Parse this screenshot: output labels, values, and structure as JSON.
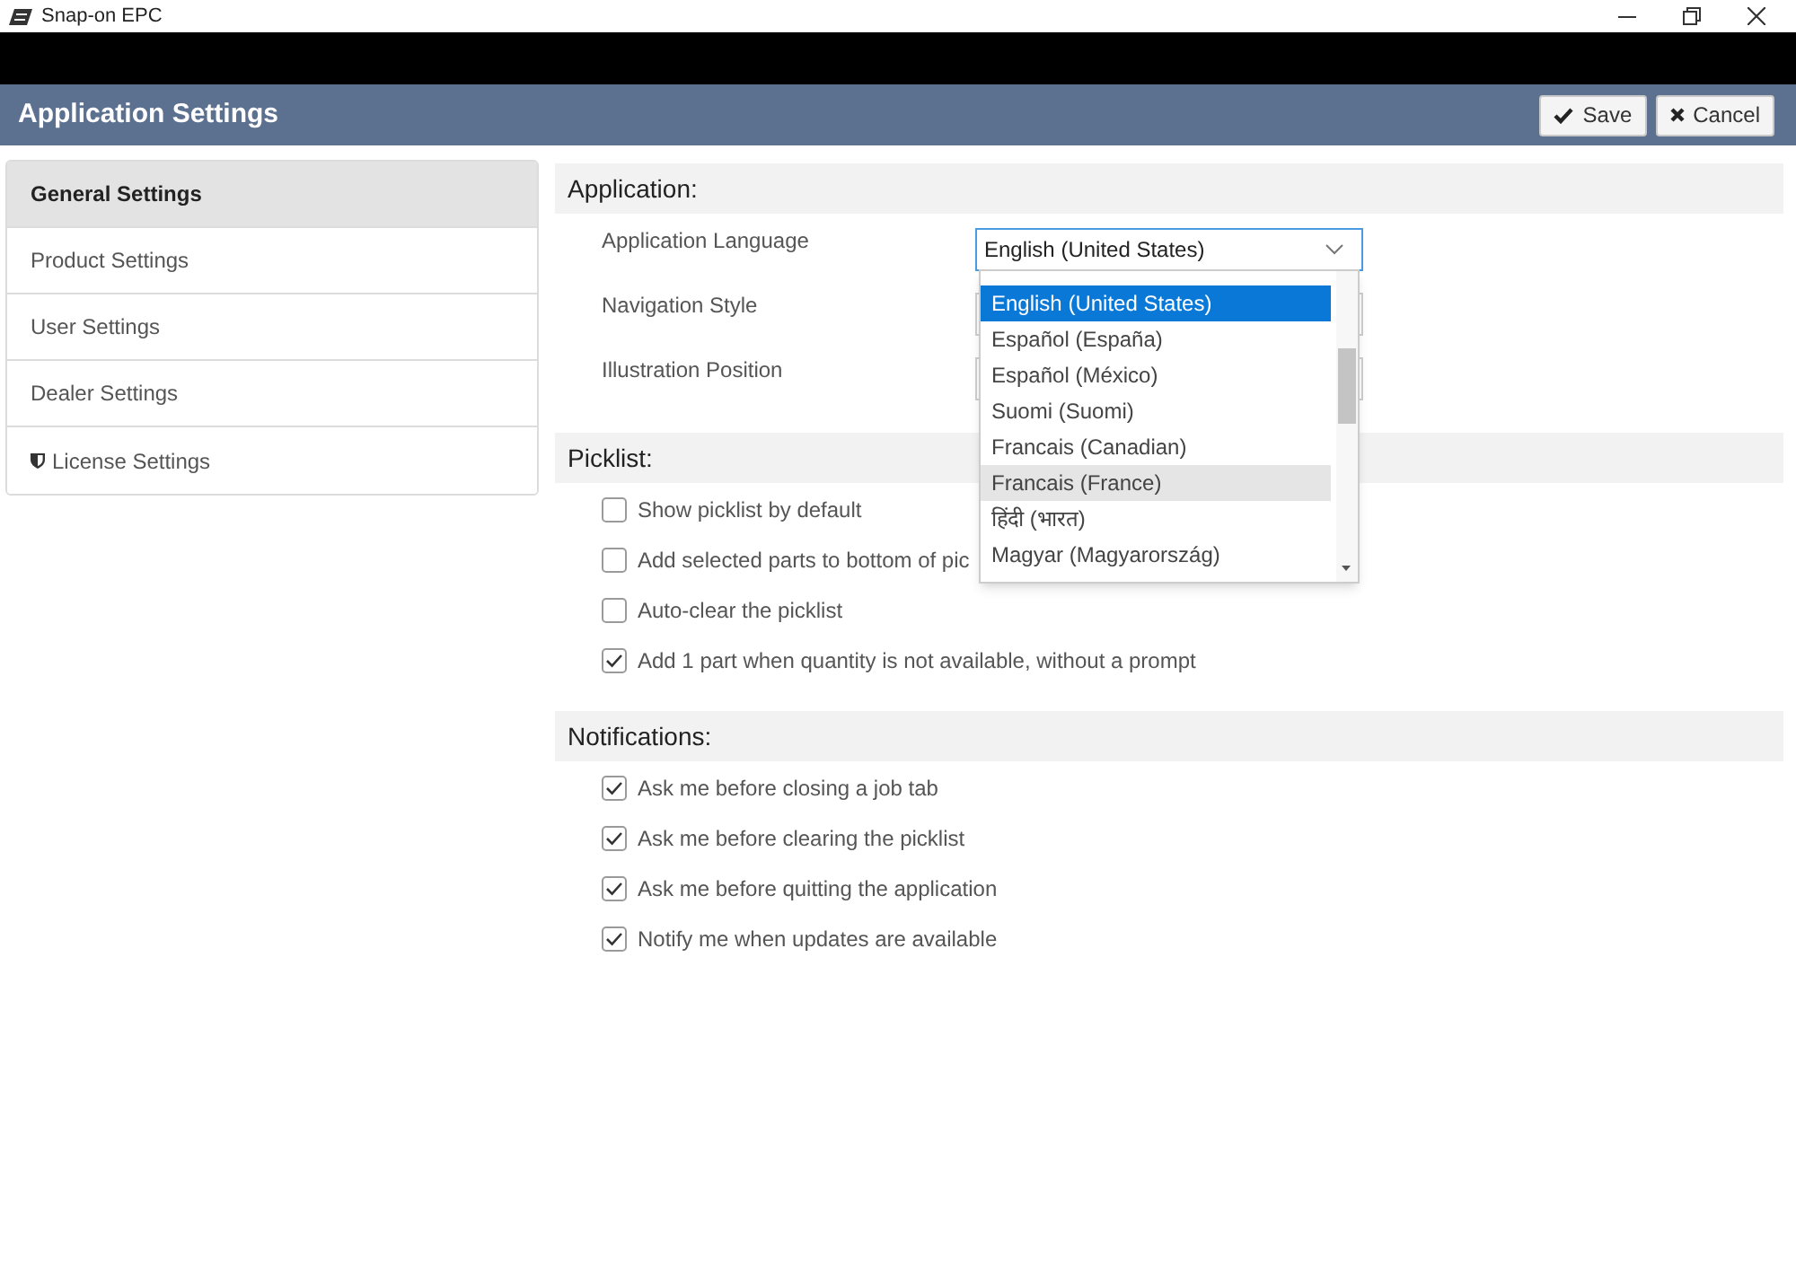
{
  "window": {
    "title": "Snap-on EPC",
    "controls": [
      {
        "kind": "minimize"
      },
      {
        "kind": "restore"
      },
      {
        "kind": "close"
      }
    ]
  },
  "header": {
    "title": "Application Settings",
    "buttons": [
      {
        "kind": "save",
        "label": "Save"
      },
      {
        "kind": "cancel",
        "label": "Cancel"
      }
    ]
  },
  "sidebar": {
    "items": [
      {
        "label": "General Settings",
        "selected": true,
        "kind": "plain"
      },
      {
        "label": "Product Settings",
        "selected": false,
        "kind": "plain"
      },
      {
        "label": "User Settings",
        "selected": false,
        "kind": "plain"
      },
      {
        "label": "Dealer Settings",
        "selected": false,
        "kind": "plain"
      },
      {
        "label": "License Settings",
        "selected": false,
        "kind": "icon"
      }
    ]
  },
  "sections": [
    {
      "kind": "selects",
      "title": "Application:",
      "items": [
        {
          "label": "Application Language",
          "value": "English (United States)",
          "focused": true,
          "options": [
            {
              "label": "English (United States)",
              "selected": true,
              "hovered": false
            },
            {
              "label": "Español (España)",
              "selected": false,
              "hovered": false
            },
            {
              "label": "Español (México)",
              "selected": false,
              "hovered": false
            },
            {
              "label": "Suomi (Suomi)",
              "selected": false,
              "hovered": false
            },
            {
              "label": "Francais (Canadian)",
              "selected": false,
              "hovered": false
            },
            {
              "label": "Francais (France)",
              "selected": false,
              "hovered": true
            },
            {
              "label": "हिंदी (भारत)",
              "selected": false,
              "hovered": false
            },
            {
              "label": "Magyar (Magyarország)",
              "selected": false,
              "hovered": false
            }
          ]
        },
        {
          "label": "Navigation Style"
        },
        {
          "label": "Illustration Position"
        }
      ]
    },
    {
      "kind": "checkboxes",
      "title": "Picklist:",
      "items": [
        {
          "label": "Show picklist by default",
          "checked": false
        },
        {
          "label": "Add selected parts to bottom of pic",
          "checked": false
        },
        {
          "label": "Auto-clear the picklist",
          "checked": false
        },
        {
          "label": "Add 1 part when quantity is not available, without a prompt",
          "checked": true
        }
      ]
    },
    {
      "kind": "checkboxes",
      "title": "Notifications:",
      "items": [
        {
          "label": "Ask me before closing a job tab",
          "checked": true
        },
        {
          "label": "Ask me before clearing the picklist",
          "checked": true
        },
        {
          "label": "Ask me before quitting the application",
          "checked": true
        },
        {
          "label": "Notify me when updates are available",
          "checked": true
        }
      ]
    }
  ]
}
